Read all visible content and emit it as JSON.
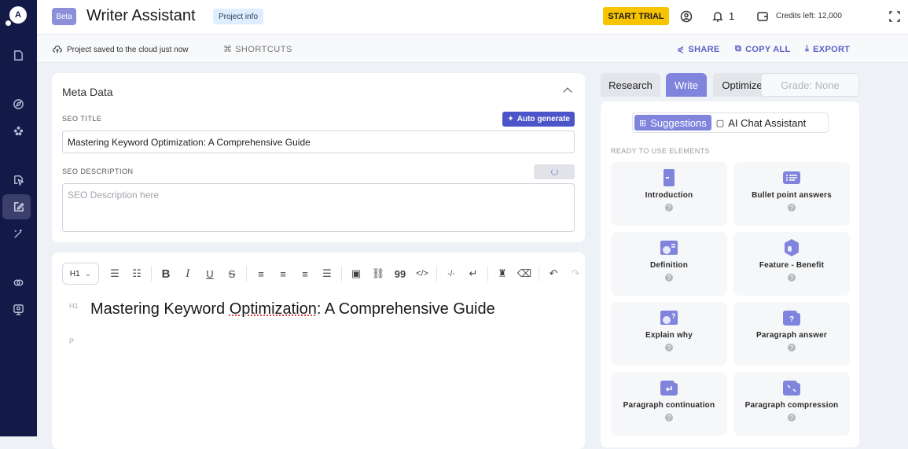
{
  "app": {
    "beta_label": "Beta",
    "title": "Writer Assistant",
    "project_info_label": "Project info"
  },
  "header": {
    "start_trial_label": "START TRIAL",
    "notification_count": "1",
    "credits_label": "Credits left: 12,000"
  },
  "subbar": {
    "saved_status": "Project saved to the cloud just now",
    "shortcuts_label": "SHORTCUTS",
    "share_label": "SHARE",
    "copy_all_label": "COPY ALL",
    "export_label": "EXPORT"
  },
  "sidebar": {
    "logo_text": "A",
    "items": [
      {
        "icon": "document-icon"
      },
      {
        "icon": "compass-icon"
      },
      {
        "icon": "cluster-icon"
      },
      {
        "icon": "pen-tool-icon"
      },
      {
        "icon": "edit-icon",
        "active": true
      },
      {
        "icon": "magic-wand-icon"
      },
      {
        "icon": "link-circles-icon"
      },
      {
        "icon": "monitor-user-icon"
      }
    ]
  },
  "meta": {
    "title": "Meta Data",
    "seo_title_label": "SEO TITLE",
    "auto_generate_label": "Auto generate",
    "seo_title_value": "Mastering Keyword Optimization: A Comprehensive Guide",
    "seo_description_label": "SEO DESCRIPTION",
    "seo_description_placeholder": "SEO Description here"
  },
  "editor": {
    "heading_select": "H1",
    "h1_tag": "H1",
    "p_tag": "P",
    "h1_text_before": "Mastering Keyword ",
    "h1_text_misspelled": "Optimization",
    "h1_text_after": ": A Comprehensive Guide",
    "toolbar": [
      "bullet-list",
      "ordered-list",
      "bold",
      "italic",
      "underline",
      "strikethrough",
      "align-left",
      "align-center",
      "align-right",
      "align-justify",
      "image",
      "link",
      "quote",
      "code",
      "horizontal-rule",
      "line-break",
      "highlight",
      "clear-format",
      "undo",
      "redo"
    ]
  },
  "right_panel": {
    "tabs": [
      {
        "label": "Research"
      },
      {
        "label": "Write",
        "active": true
      },
      {
        "label": "Optimize"
      }
    ],
    "grade_label": "Grade: None",
    "segments": [
      {
        "label": "Suggestions",
        "active": true
      },
      {
        "label": "AI Chat Assistant"
      }
    ],
    "section_label": "READY TO USE ELEMENTS",
    "elements": [
      {
        "label": "Introduction"
      },
      {
        "label": "Bullet point answers"
      },
      {
        "label": "Definition"
      },
      {
        "label": "Feature - Benefit"
      },
      {
        "label": "Explain why"
      },
      {
        "label": "Paragraph answer"
      },
      {
        "label": "Paragraph continuation"
      },
      {
        "label": "Paragraph compression"
      }
    ],
    "help_glyph": "?"
  },
  "colors": {
    "sidebar": "#141a48",
    "accent": "#8084dc",
    "primary": "#4c55c7",
    "trial": "#f8c300"
  }
}
